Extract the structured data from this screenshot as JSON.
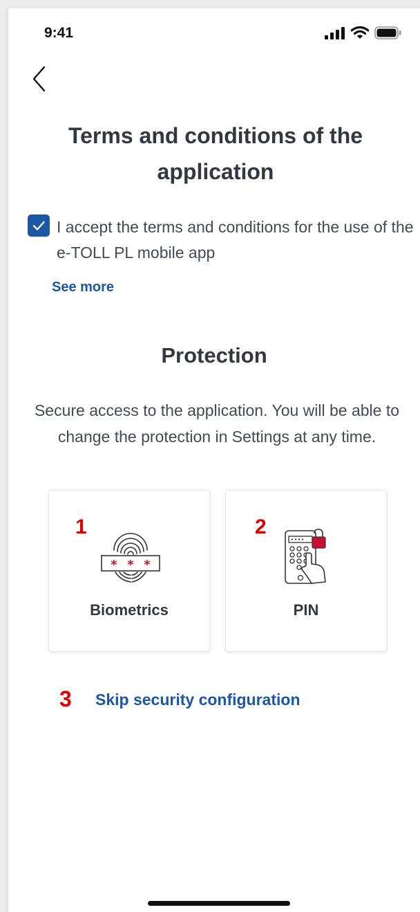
{
  "status_bar": {
    "time": "9:41",
    "icons": [
      "signal-icon",
      "wifi-icon",
      "battery-icon"
    ]
  },
  "nav": {
    "back_icon": "chevron-left-icon"
  },
  "terms": {
    "title": "Terms and conditions of the application",
    "checkbox_checked": true,
    "accept_text": "I accept the terms and conditions for the use of the e-TOLL PL mobile app",
    "see_more_label": "See more"
  },
  "protection": {
    "title": "Protection",
    "description": "Secure access to the application. You will be able to change the protection in Settings at any time.",
    "options": [
      {
        "number": "1",
        "label": "Biometrics",
        "icon": "fingerprint-password-icon"
      },
      {
        "number": "2",
        "label": "PIN",
        "icon": "phone-pin-lock-icon"
      }
    ],
    "skip_number": "3",
    "skip_label": "Skip security configuration"
  },
  "colors": {
    "accent": "#1b57a3",
    "heading": "#333840",
    "body_text": "#444a52",
    "annotation_red": "#e00000"
  }
}
